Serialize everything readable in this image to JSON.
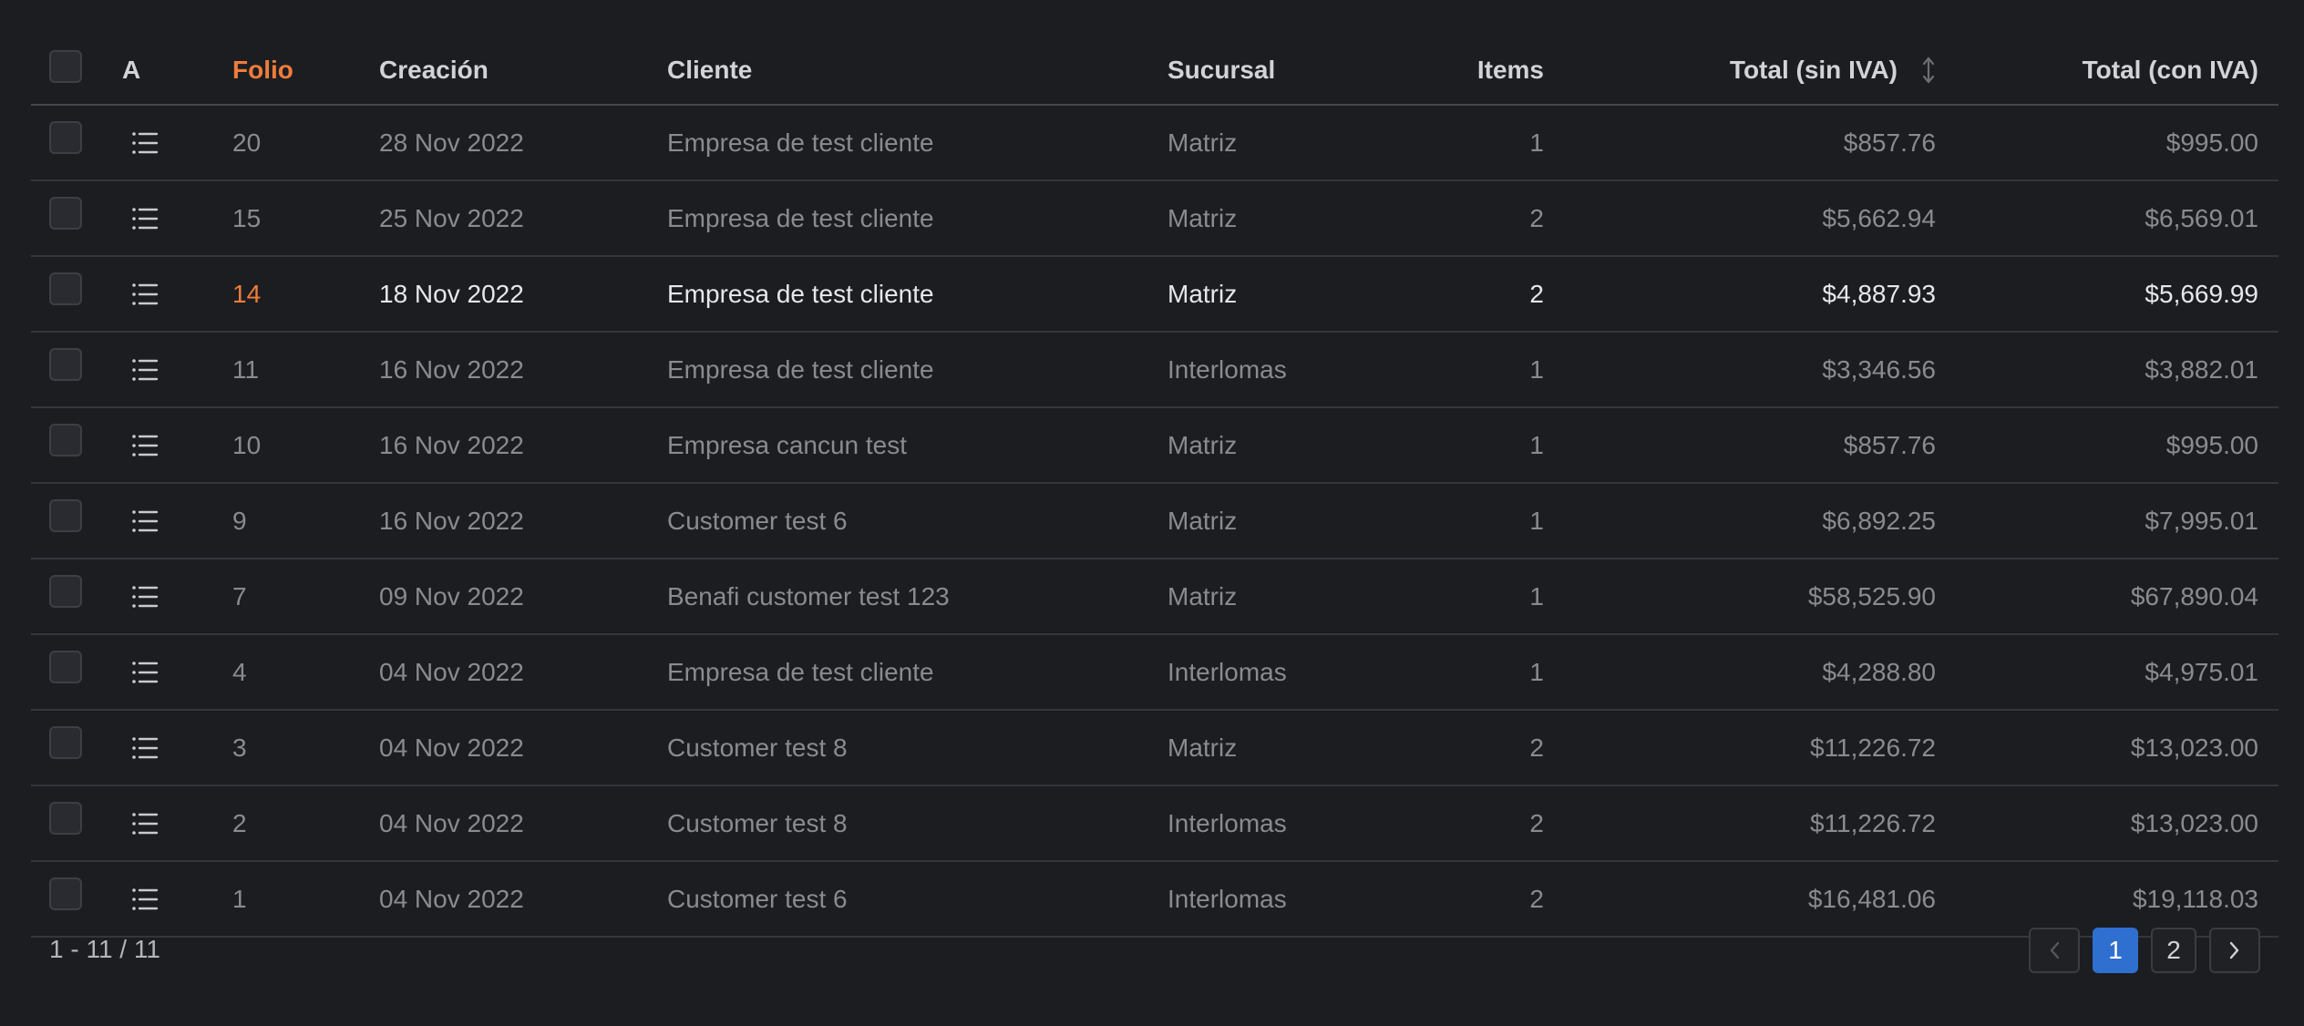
{
  "columns": {
    "a": "A",
    "folio": "Folio",
    "creacion": "Creación",
    "cliente": "Cliente",
    "sucursal": "Sucursal",
    "items": "Items",
    "total_sin": "Total (sin IVA)",
    "total_con": "Total (con IVA)"
  },
  "rows": [
    {
      "folio": "20",
      "creacion": "28 Nov 2022",
      "cliente": "Empresa de test cliente",
      "sucursal": "Matriz",
      "items": "1",
      "total_sin": "$857.76",
      "total_con": "$995.00"
    },
    {
      "folio": "15",
      "creacion": "25 Nov 2022",
      "cliente": "Empresa de test cliente",
      "sucursal": "Matriz",
      "items": "2",
      "total_sin": "$5,662.94",
      "total_con": "$6,569.01"
    },
    {
      "folio": "14",
      "creacion": "18 Nov 2022",
      "cliente": "Empresa de test cliente",
      "sucursal": "Matriz",
      "items": "2",
      "total_sin": "$4,887.93",
      "total_con": "$5,669.99"
    },
    {
      "folio": "11",
      "creacion": "16 Nov 2022",
      "cliente": "Empresa de test cliente",
      "sucursal": "Interlomas",
      "items": "1",
      "total_sin": "$3,346.56",
      "total_con": "$3,882.01"
    },
    {
      "folio": "10",
      "creacion": "16 Nov 2022",
      "cliente": "Empresa cancun test",
      "sucursal": "Matriz",
      "items": "1",
      "total_sin": "$857.76",
      "total_con": "$995.00"
    },
    {
      "folio": "9",
      "creacion": "16 Nov 2022",
      "cliente": "Customer test 6",
      "sucursal": "Matriz",
      "items": "1",
      "total_sin": "$6,892.25",
      "total_con": "$7,995.01"
    },
    {
      "folio": "7",
      "creacion": "09 Nov 2022",
      "cliente": "Benafi customer test 123",
      "sucursal": "Matriz",
      "items": "1",
      "total_sin": "$58,525.90",
      "total_con": "$67,890.04"
    },
    {
      "folio": "4",
      "creacion": "04 Nov 2022",
      "cliente": "Empresa de test cliente",
      "sucursal": "Interlomas",
      "items": "1",
      "total_sin": "$4,288.80",
      "total_con": "$4,975.01"
    },
    {
      "folio": "3",
      "creacion": "04 Nov 2022",
      "cliente": "Customer test 8",
      "sucursal": "Matriz",
      "items": "2",
      "total_sin": "$11,226.72",
      "total_con": "$13,023.00"
    },
    {
      "folio": "2",
      "creacion": "04 Nov 2022",
      "cliente": "Customer test 8",
      "sucursal": "Interlomas",
      "items": "2",
      "total_sin": "$11,226.72",
      "total_con": "$13,023.00"
    },
    {
      "folio": "1",
      "creacion": "04 Nov 2022",
      "cliente": "Customer test 6",
      "sucursal": "Interlomas",
      "items": "2",
      "total_sin": "$16,481.06",
      "total_con": "$19,118.03"
    }
  ],
  "pagination": {
    "range": "1 - 11 / 11",
    "pages": [
      "1",
      "2"
    ]
  },
  "icons": {
    "row_action": "list-icon",
    "sort": "sort-icon",
    "prev": "chevron-left-icon",
    "next": "chevron-right-icon"
  },
  "colors": {
    "background": "#1c1d21",
    "accent": "#ee7d3a",
    "active_page": "#2f6fd0"
  }
}
